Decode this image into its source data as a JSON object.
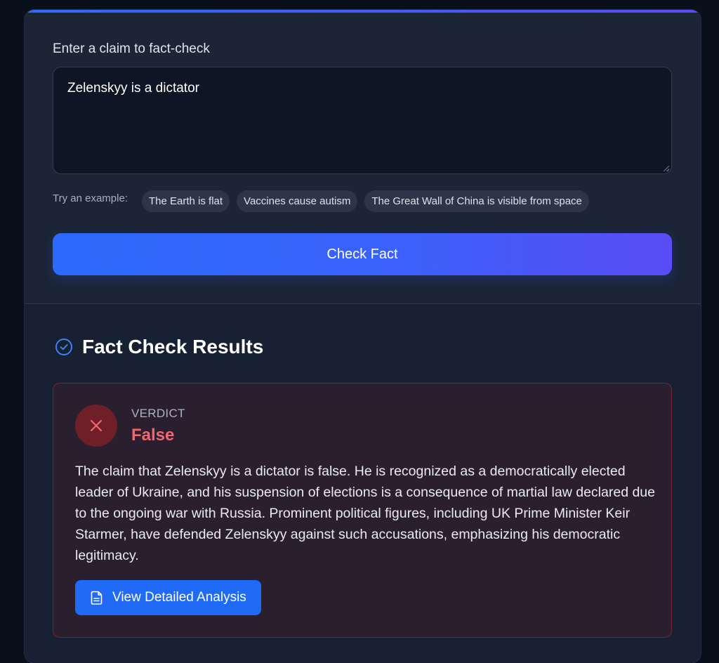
{
  "input": {
    "label": "Enter a claim to fact-check",
    "value": "Zelenskyy is a dictator"
  },
  "examples": {
    "label": "Try an example:",
    "items": [
      "The Earth is flat",
      "Vaccines cause autism",
      "The Great Wall of China is visible from space"
    ]
  },
  "check_button": {
    "label": "Check Fact"
  },
  "results": {
    "title": "Fact Check Results",
    "icon": "check-circle-icon",
    "verdict": {
      "label": "VERDICT",
      "value": "False",
      "icon": "x-mark-icon",
      "explanation": "The claim that Zelenskyy is a dictator is false. He is recognized as a democratically elected leader of Ukraine, and his suspension of elections is a consequence of martial law declared due to the ongoing war with Russia. Prominent political figures, including UK Prime Minister Keir Starmer, have defended Zelenskyy against such accusations, emphasizing his democratic legitimacy."
    },
    "analysis_button": {
      "label": "View Detailed Analysis",
      "icon": "document-icon"
    }
  },
  "colors": {
    "accent": "#2b69fb",
    "accent_end": "#5a4cf6",
    "false_red": "#f2676e"
  }
}
